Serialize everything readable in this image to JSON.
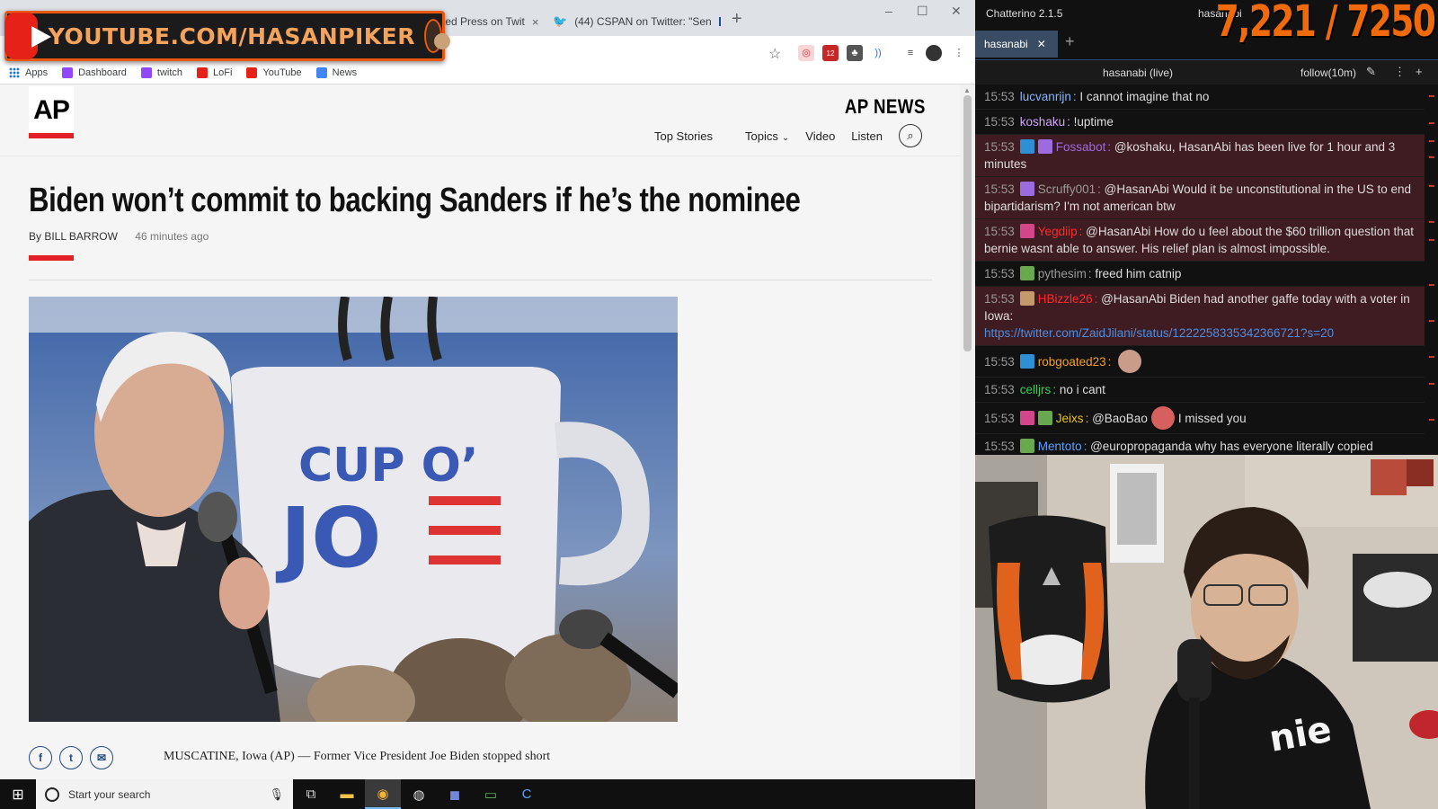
{
  "browser": {
    "tabs": [
      {
        "label": "Associated Press on Twit",
        "close": "×"
      },
      {
        "label": "(44) CSPAN on Twitter: \"Sen",
        "close": "×"
      }
    ],
    "new_tab": "+",
    "window_controls": {
      "minimize": "–",
      "maximize": "☐",
      "close": "✕"
    },
    "bookmarks": [
      {
        "label": "Apps"
      },
      {
        "label": "Dashboard"
      },
      {
        "label": "twitch"
      },
      {
        "label": "LoFi"
      },
      {
        "label": "YouTube"
      },
      {
        "label": "News"
      }
    ],
    "ext_badge": "12"
  },
  "overlay": {
    "youtube_text": "YOUTUBE.COM/HASANPIKER"
  },
  "article": {
    "site": "AP NEWS",
    "logo": "AP",
    "nav": [
      "Top Stories",
      "Topics",
      "Video",
      "Listen"
    ],
    "headline": "Biden won’t commit to backing Sanders if he’s the nominee",
    "byline": "By BILL BARROW",
    "time_ago": "46 minutes ago",
    "photo_text": {
      "line1": "CUP O’",
      "line2": "JO"
    },
    "lede": "MUSCATINE, Iowa (AP) — Former Vice President Joe Biden stopped short",
    "share": [
      "f",
      "t",
      "✉"
    ]
  },
  "taskbar": {
    "search_placeholder": "Start your search",
    "icons": [
      "task-view",
      "file-explorer",
      "chrome",
      "obs",
      "discord",
      "app-green",
      "chatterino"
    ]
  },
  "chat": {
    "app_title": "Chatterino 2.1.5",
    "account": "hasanabi",
    "sub_goal": "7,221 / 7250",
    "tab_label": "hasanabi",
    "channel_status": "hasanabi (live)",
    "follow_mode": "follow(10m)",
    "messages": [
      {
        "time": "15:53",
        "user": "lucvanrijn",
        "user_color": "#8ab4f8",
        "text": "I cannot imagine that no",
        "hl": false
      },
      {
        "time": "15:53",
        "user": "koshaku",
        "user_color": "#cda6f7",
        "text": "!uptime",
        "hl": false
      },
      {
        "time": "15:53",
        "user": "Fossabot",
        "user_color": "#9c6bdf",
        "text": "@koshaku, HasanAbi has been live for 1 hour and 3 minutes",
        "hl": true
      },
      {
        "time": "15:53",
        "user": "Scruffy001",
        "user_color": "#9a9a9a",
        "text": "@HasanAbi Would it be unconstitutional in the US to end bipartidarism? I'm not american btw",
        "hl": true
      },
      {
        "time": "15:53",
        "user": "Yegdiip",
        "user_color": "#ff2a2a",
        "text": "@HasanAbi How do u feel about the $60 trillion question that bernie wasnt able to answer. His relief plan is almost impossible.",
        "hl": true
      },
      {
        "time": "15:53",
        "user": "pythesim",
        "user_color": "#9a9a9a",
        "text": "freed him catnip",
        "hl": false
      },
      {
        "time": "15:53",
        "user": "HBizzle26",
        "user_color": "#ff2a2a",
        "text": "@HasanAbi Biden had another gaffe today with a voter in Iowa:",
        "link": "https://twitter.com/ZaidJilani/status/1222258335342366721?s=20",
        "hl": true
      },
      {
        "time": "15:53",
        "user": "robgoated23",
        "user_color": "#f0a020",
        "text": "",
        "hl": false
      },
      {
        "time": "15:53",
        "user": "celljrs",
        "user_color": "#34d058",
        "text": "no i cant",
        "hl": false
      },
      {
        "time": "15:53",
        "user": "Jeixs",
        "user_color": "#e6c21a",
        "text": "@BaoBao",
        "text2": "I missed you",
        "hl": false
      },
      {
        "time": "15:53",
        "user": "Mentoto",
        "user_color": "#5aa0ff",
        "text": "@europropaganda why has everyone literally copied",
        "hl": false
      }
    ]
  },
  "colors": {
    "ap_red": "#e21f24",
    "chat_highlight": "#3f1b22",
    "sub_goal": "#f06a0c",
    "youtube_red": "#e62117"
  }
}
